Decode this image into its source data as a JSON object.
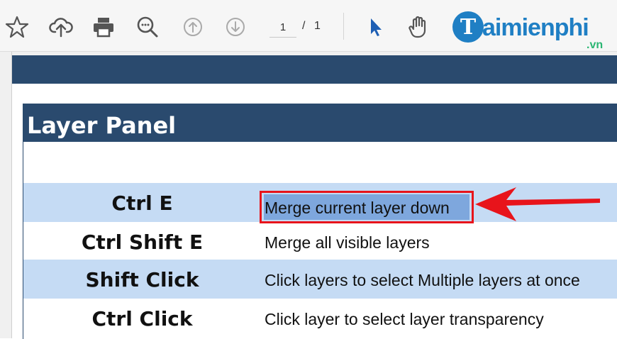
{
  "toolbar": {
    "page_current": "1",
    "page_separator": "/",
    "page_total": "1",
    "icons": [
      "star-icon",
      "upload-cloud-icon",
      "print-icon",
      "zoom-icon",
      "page-up-icon",
      "page-down-icon",
      "select-cursor-icon",
      "hand-icon"
    ]
  },
  "watermark": {
    "badge_letter": "T",
    "text": "aimienphi",
    "sub": ".vn"
  },
  "panel": {
    "title": "Layer Panel",
    "rows": [
      {
        "key": "Ctrl E",
        "desc": "Merge current layer down",
        "highlighted": true
      },
      {
        "key": "Ctrl Shift E",
        "desc": "Merge all visible layers",
        "highlighted": false
      },
      {
        "key": "Shift Click",
        "desc": "Click layers to select Multiple layers at once",
        "highlighted": false
      },
      {
        "key": "Ctrl Click",
        "desc": "Click layer to select layer transparency",
        "highlighted": false
      }
    ]
  },
  "colors": {
    "header_bg": "#2a4a6e",
    "row_alt": "#c5dbf4",
    "highlight_border": "#e8141b",
    "arrow": "#e8141b",
    "selection": "#7ea7dd"
  }
}
